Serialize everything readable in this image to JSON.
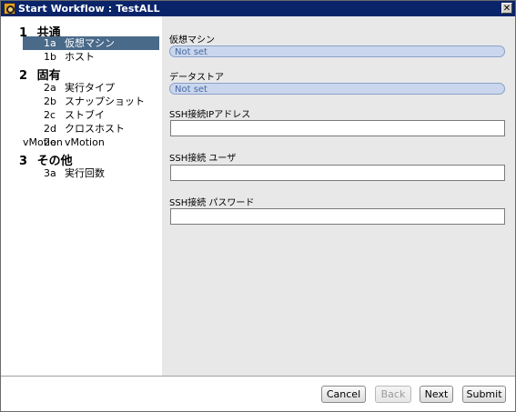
{
  "window": {
    "title": "Start Workflow : TestALL",
    "close_glyph": "✕"
  },
  "sidebar": {
    "groups": [
      {
        "num": "1",
        "label": "共通"
      },
      {
        "num": "2",
        "label": "固有"
      },
      {
        "num": "3",
        "label": "その他"
      }
    ],
    "items": [
      {
        "num": "1a",
        "label": "仮想マシン"
      },
      {
        "num": "1b",
        "label": "ホスト"
      },
      {
        "num": "2a",
        "label": "実行タイプ"
      },
      {
        "num": "2b",
        "label": "スナップショット"
      },
      {
        "num": "2c",
        "label": "ストブイ"
      },
      {
        "num": "2d",
        "label": "クロスホストvMotion"
      },
      {
        "num": "2e",
        "label": "vMotion"
      },
      {
        "num": "3a",
        "label": "実行回数"
      }
    ],
    "selected_item": "1a"
  },
  "form": {
    "vm_label": "仮想マシン",
    "vm_value": "Not set",
    "datastore_label": "データストア",
    "datastore_value": "Not set",
    "ssh_ip_label": "SSH接続IPアドレス",
    "ssh_ip_value": "",
    "ssh_user_label": "SSH接続 ユーザ",
    "ssh_user_value": "",
    "ssh_password_label": "SSH接続 パスワード",
    "ssh_password_value": ""
  },
  "footer": {
    "cancel": "Cancel",
    "back": "Back",
    "next": "Next",
    "submit": "Submit"
  },
  "colors": {
    "titlebar": "#0a246a",
    "selected_item": "#4a6a8a",
    "pill_fill": "#c9d6ee",
    "content_bg": "#e8e8e8"
  }
}
